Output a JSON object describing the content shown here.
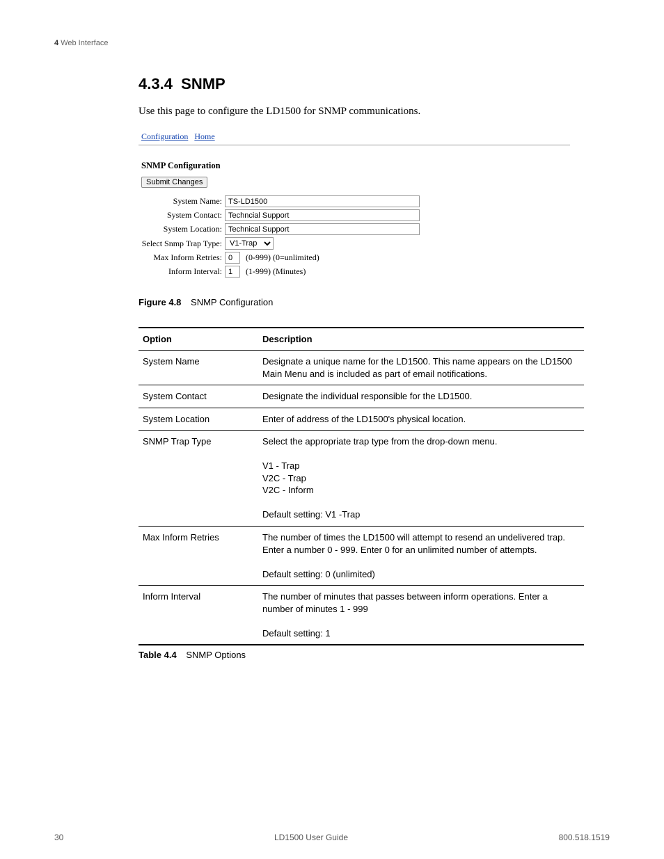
{
  "header": {
    "chapter_number": "4",
    "chapter_title": "Web Interface"
  },
  "section": {
    "number": "4.3.4",
    "title": "SNMP",
    "intro": "Use this page to configure the LD1500 for SNMP communications."
  },
  "screenshot": {
    "nav": {
      "configuration": "Configuration",
      "home": "Home"
    },
    "heading": "SNMP Configuration",
    "submit_label": "Submit Changes",
    "fields": {
      "system_name": {
        "label": "System Name:",
        "value": "TS-LD1500"
      },
      "system_contact": {
        "label": "System Contact:",
        "value": "Techncial Support"
      },
      "system_location": {
        "label": "System Location:",
        "value": "Technical Support"
      },
      "trap_type": {
        "label": "Select Snmp Trap Type:",
        "value": "V1-Trap"
      },
      "max_inform_retries": {
        "label": "Max Inform Retries:",
        "value": "0",
        "hint": "(0-999) (0=unlimited)"
      },
      "inform_interval": {
        "label": "Inform Interval:",
        "value": "1",
        "hint": "(1-999) (Minutes)"
      }
    }
  },
  "figure": {
    "label": "Figure 4.8",
    "title": "SNMP Configuration"
  },
  "table": {
    "headers": {
      "option": "Option",
      "description": "Description"
    },
    "rows": [
      {
        "option": "System Name",
        "description": "Designate a unique name for the LD1500. This name appears on the LD1500 Main Menu and is included as part of email notifications."
      },
      {
        "option": "System Contact",
        "description": "Designate the individual responsible for the LD1500."
      },
      {
        "option": "System Location",
        "description": "Enter of address of the LD1500's physical location."
      },
      {
        "option": "SNMP Trap Type",
        "description": "Select the appropriate trap type from the drop-down menu.\n\nV1 - Trap\nV2C - Trap\nV2C - Inform\n\nDefault setting: V1 -Trap"
      },
      {
        "option": "Max Inform Retries",
        "description": "The number of times the LD1500 will attempt to resend an undelivered trap. Enter a number 0 - 999. Enter 0 for an unlimited number of attempts.\n\nDefault setting: 0 (unlimited)"
      },
      {
        "option": "Inform Interval",
        "description": "The number of minutes that passes between inform operations. Enter a number of minutes 1 - 999\n\nDefault setting: 1"
      }
    ],
    "caption": {
      "label": "Table 4.4",
      "title": "SNMP Options"
    }
  },
  "footer": {
    "page": "30",
    "doc_title": "LD1500 User Guide",
    "phone": "800.518.1519"
  }
}
